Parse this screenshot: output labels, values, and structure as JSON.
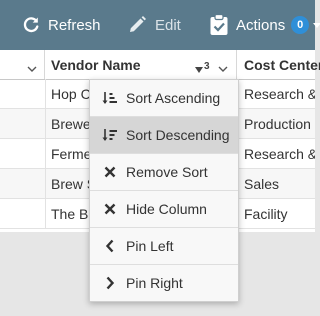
{
  "toolbar": {
    "refresh_label": "Refresh",
    "edit_label": "Edit",
    "actions_label": "Actions",
    "actions_count": "0"
  },
  "grid": {
    "columns": [
      "",
      "Vendor Name",
      "Cost Center"
    ],
    "sort_indicator": "3",
    "rows": [
      {
        "vendor": "Hop C",
        "cost_center": "Research &"
      },
      {
        "vendor": "Brewe",
        "cost_center": "Production"
      },
      {
        "vendor": "Ferme",
        "cost_center": "Research &"
      },
      {
        "vendor": "Brew S",
        "cost_center": "Sales"
      },
      {
        "vendor": "The B",
        "cost_center": "Facility"
      }
    ]
  },
  "column_menu": {
    "items": [
      {
        "label": "Sort Ascending",
        "icon": "sort-ascending-icon"
      },
      {
        "label": "Sort Descending",
        "icon": "sort-descending-icon"
      },
      {
        "label": "Remove Sort",
        "icon": "x-icon"
      },
      {
        "label": "Hide Column",
        "icon": "x-icon"
      },
      {
        "label": "Pin Left",
        "icon": "chevron-left-icon"
      },
      {
        "label": "Pin Right",
        "icon": "chevron-right-icon"
      }
    ],
    "active_item": "Sort Descending"
  },
  "colors": {
    "toolbar_bg": "#5a7a8c",
    "badge_bg": "#2f8fd8",
    "menu_active_bg": "#d6d6d6",
    "page_bg": "#e6e6e6"
  }
}
